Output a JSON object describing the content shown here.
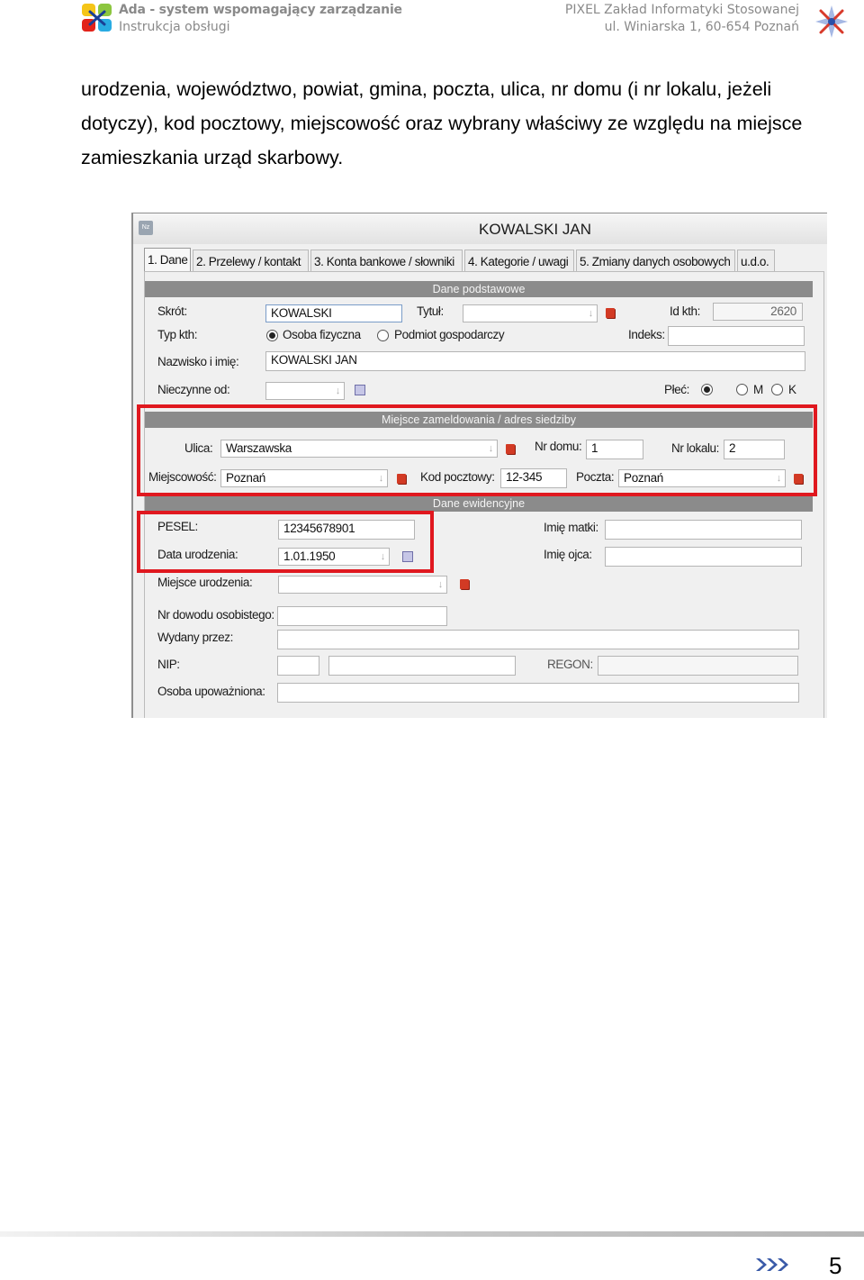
{
  "header": {
    "app_title": "Ada - system wspomagający zarządzanie",
    "subtitle": "Instrukcja obsługi",
    "company": "PIXEL Zakład Informatyki Stosowanej",
    "address": "ul. Winiarska 1, 60-654 Poznań"
  },
  "body_text": "urodzenia, województwo, powiat, gmina, poczta, ulica, nr domu (i nr lokalu, jeżeli dotyczy), kod pocztowy, miejscowość oraz wybrany właściwy ze względu na miejsce zamieszkania urząd skarbowy.",
  "window": {
    "title": "KOWALSKI JAN",
    "tabs": [
      "1. Dane",
      "2. Przelewy / kontakt",
      "3. Konta bankowe / słowniki",
      "4. Kategorie / uwagi",
      "5. Zmiany danych osobowych",
      "u.d.o."
    ],
    "active_tab": "1. Dane"
  },
  "sections": {
    "basic": "Dane podstawowe",
    "address": "Miejsce zameldowania / adres siedziby",
    "records": "Dane ewidencyjne"
  },
  "basic": {
    "skrot_label": "Skrót:",
    "skrot_value": "KOWALSKI",
    "tytul_label": "Tytuł:",
    "tytul_value": "",
    "id_label": "Id kth:",
    "id_value": "2620",
    "typ_label": "Typ kth:",
    "typ_option1": "Osoba fizyczna",
    "typ_option2": "Podmiot gospodarczy",
    "typ_selected": "Osoba fizyczna",
    "indeks_label": "Indeks:",
    "indeks_value": "",
    "nazwisko_label": "Nazwisko i imię:",
    "nazwisko_value": "KOWALSKI JAN",
    "nieczynne_label": "Nieczynne od:",
    "nieczynne_value": "",
    "plec_label": "Płeć:",
    "plec_m": "M",
    "plec_k": "K"
  },
  "address": {
    "ulica_label": "Ulica:",
    "ulica_value": "Warszawska",
    "nr_domu_label": "Nr domu:",
    "nr_domu_value": "1",
    "nr_lokalu_label": "Nr lokalu:",
    "nr_lokalu_value": "2",
    "miejscowosc_label": "Miejscowość:",
    "miejscowosc_value": "Poznań",
    "kod_label": "Kod pocztowy:",
    "kod_value": "12-345",
    "poczta_label": "Poczta:",
    "poczta_value": "Poznań"
  },
  "records": {
    "pesel_label": "PESEL:",
    "pesel_value": "12345678901",
    "data_ur_label": "Data urodzenia:",
    "data_ur_value": "1.01.1950",
    "imie_matki_label": "Imię matki:",
    "imie_matki_value": "",
    "imie_ojca_label": "Imię ojca:",
    "imie_ojca_value": "",
    "miejsce_ur_label": "Miejsce urodzenia:",
    "miejsce_ur_value": "",
    "dowod_label": "Nr dowodu osobistego:",
    "dowod_value": "",
    "wydany_label": "Wydany przez:",
    "wydany_value": "",
    "nip_label": "NIP:",
    "regon_label": "REGON:",
    "upowazniona_label": "Osoba upoważniona:"
  },
  "footer": {
    "page_number": "5"
  }
}
